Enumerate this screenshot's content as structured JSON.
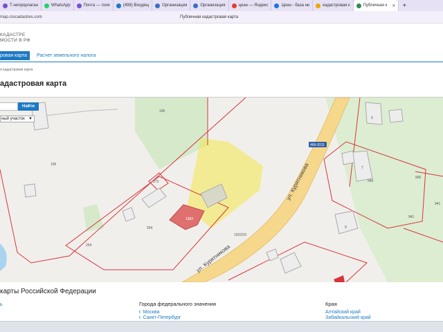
{
  "browser": {
    "tabs": [
      {
        "label": "Т-непрорлаган",
        "icon_color": "#7b4fd1"
      },
      {
        "label": "WhatsApp",
        "icon_color": "#25d366"
      },
      {
        "label": "Почта — голе",
        "icon_color": "#7b4fd1"
      },
      {
        "label": "(498) Входящ",
        "icon_color": "#1d79c2"
      },
      {
        "label": "Организация",
        "icon_color": "#3a6fc4"
      },
      {
        "label": "Организация",
        "icon_color": "#3a6fc4"
      },
      {
        "label": "циан — Яндекс",
        "icon_color": "#e63c2f"
      },
      {
        "label": "Циан - база не",
        "icon_color": "#1a73e8"
      },
      {
        "label": "кадастровая к",
        "icon_color": "#f0a500"
      },
      {
        "label": "Публичная к",
        "icon_color": "#2e8b57"
      }
    ],
    "new_tab": "+",
    "url": "map.roscadastres.com",
    "page_title": "Публичная кадастровая карта"
  },
  "site": {
    "logo_line1": "КАДАСТРЕ",
    "logo_line2": "МОСТИ В РФ",
    "nav": {
      "active": "ровая карта",
      "link": "Расчет земельного налога"
    },
    "breadcrumb": "я кадастровая карта",
    "heading": "адастровая карта"
  },
  "map": {
    "search_placeholder": "",
    "search_button": "Найти",
    "type_select": "ный участок",
    "labels": {
      "l195a": "195",
      "l195b": "195",
      "l5": "5",
      "l7": "7",
      "l9": "9",
      "l273": "273",
      "l254a": "254",
      "l254b": "254",
      "l1982": "1982",
      "l12022": "12022/3",
      "l940": "940",
      "l941a": "941",
      "l941b": "941",
      "l900": "900",
      "shield": "46К-9311",
      "street1": "ул. Курятникова",
      "street2": "ул. Курятникова"
    },
    "colors": {
      "highlight": "#f2e84a",
      "selected": "#e07070",
      "boundary": "#d9333a",
      "green": "#d6eacb",
      "road": "#f6d88c"
    }
  },
  "bottom": {
    "heading": "карты Российской Федерации",
    "col1": {
      "item": "ь"
    },
    "col2": {
      "title": "Города федерального значения",
      "items": [
        "г. Москва",
        "г. Санкт-Петербург"
      ]
    },
    "col3": {
      "title": "Края",
      "items": [
        "Алтайский край",
        "Забайкальский край"
      ]
    }
  }
}
